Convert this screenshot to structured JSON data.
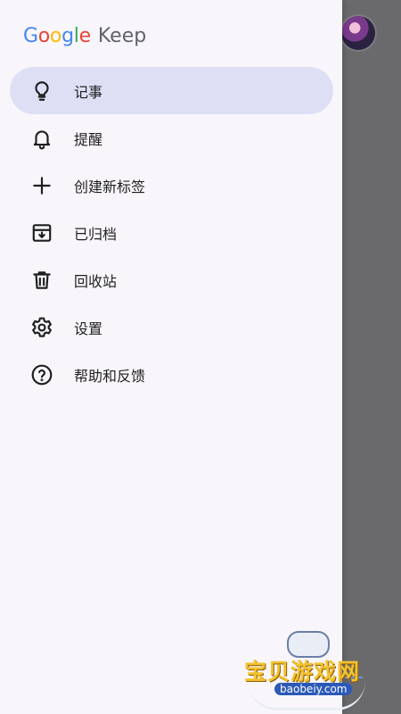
{
  "app": {
    "brand_letters": [
      {
        "ch": "G",
        "color": "#4285F4"
      },
      {
        "ch": "o",
        "color": "#EA4335"
      },
      {
        "ch": "o",
        "color": "#FBBC05"
      },
      {
        "ch": "g",
        "color": "#4285F4"
      },
      {
        "ch": "l",
        "color": "#34A853"
      },
      {
        "ch": "e",
        "color": "#EA4335"
      }
    ],
    "product": "Keep"
  },
  "drawer": {
    "items": [
      {
        "label": "记事",
        "icon": "lightbulb-icon",
        "active": true
      },
      {
        "label": "提醒",
        "icon": "bell-icon",
        "active": false
      },
      {
        "label": "创建新标签",
        "icon": "plus-icon",
        "active": false
      },
      {
        "label": "已归档",
        "icon": "archive-icon",
        "active": false
      },
      {
        "label": "回收站",
        "icon": "trash-icon",
        "active": false
      },
      {
        "label": "设置",
        "icon": "gear-icon",
        "active": false
      },
      {
        "label": "帮助和反馈",
        "icon": "help-icon",
        "active": false
      }
    ]
  },
  "watermark": {
    "cn": "宝贝游戏网",
    "url": "baobeiy.com"
  },
  "colors": {
    "drawer_bg": "#f9f6fb",
    "active_bg": "#dde0f5",
    "scrim": "#6a6a6d"
  }
}
